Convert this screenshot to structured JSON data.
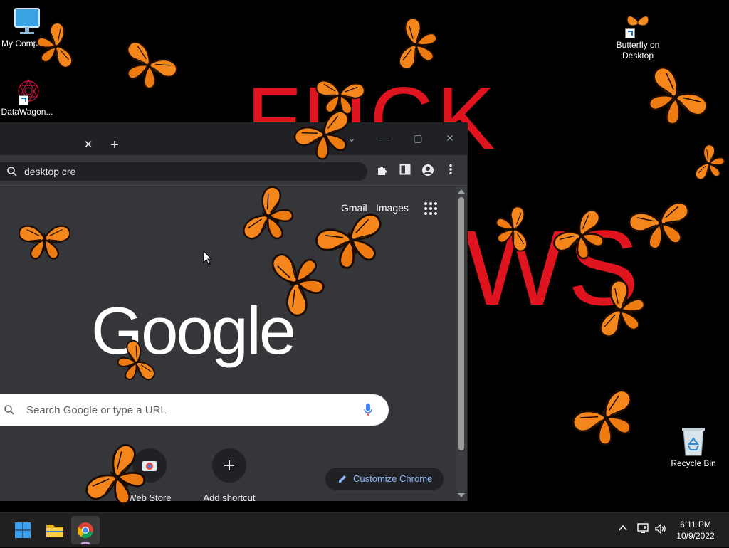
{
  "wallpaper": {
    "text_top": "FUCK",
    "text_bottom": "WS",
    "color": "#e0141e"
  },
  "desktop_icons": [
    {
      "name": "my-computer",
      "label": "My Computer"
    },
    {
      "name": "datawagon",
      "label": "DataWagon..."
    },
    {
      "name": "butterfly-on-desktop",
      "label": "Butterfly on Desktop"
    },
    {
      "name": "recycle-bin",
      "label": "Recycle Bin"
    }
  ],
  "chrome": {
    "tab_close": "✕",
    "new_tab": "+",
    "address_value": "desktop cre",
    "top_links": [
      "Gmail",
      "Images"
    ],
    "logo_text": "Google",
    "search_placeholder": "Search Google or type a URL",
    "shortcuts": [
      {
        "label": "Web Store"
      },
      {
        "label": "Add shortcut"
      }
    ],
    "customize_label": "Customize Chrome",
    "colors": {
      "frame": "#202124",
      "page": "#35363a",
      "accent": "#8ab4f8"
    }
  },
  "taskbar": {
    "time": "6:11 PM",
    "date": "10/9/2022",
    "apps": [
      "start-icon",
      "file-explorer-icon",
      "chrome-icon"
    ]
  }
}
